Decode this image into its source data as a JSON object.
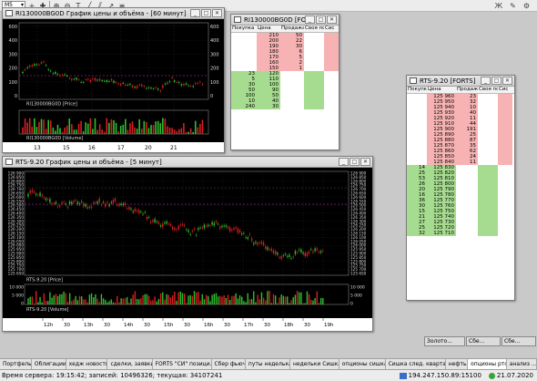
{
  "toolbar": {
    "interval": "M5"
  },
  "win1": {
    "title": "RI130000BG0D График цены и объёма - [60 минут]",
    "price_label": "RI130000BG0D [Price]",
    "volume_label": "RI130000BG0D [Volume]",
    "y_ticks": [
      "600",
      "400",
      "300",
      "200",
      "100",
      "0"
    ],
    "dates": [
      "13",
      "15",
      "16",
      "17",
      "20",
      "21"
    ]
  },
  "win2": {
    "title": "RI130000BG0D [FORTS]",
    "columns": [
      "Покупка",
      "Цена",
      "Продажа",
      "Своя по",
      "Сис"
    ],
    "asks": [
      {
        "price": "210",
        "qty": "50"
      },
      {
        "price": "200",
        "qty": "22"
      },
      {
        "price": "190",
        "qty": "30"
      },
      {
        "price": "180",
        "qty": "6"
      },
      {
        "price": "170",
        "qty": "5"
      },
      {
        "price": "160",
        "qty": "2"
      },
      {
        "price": "150",
        "qty": "1"
      }
    ],
    "bids": [
      {
        "qty": "23",
        "price": "120"
      },
      {
        "qty": "5",
        "price": "110"
      },
      {
        "qty": "30",
        "price": "100"
      },
      {
        "qty": "50",
        "price": "90"
      },
      {
        "qty": "100",
        "price": "50"
      },
      {
        "qty": "10",
        "price": "40"
      },
      {
        "qty": "240",
        "price": "30"
      }
    ]
  },
  "win3": {
    "title": "RTS-9.20 График цены и объёма - [5 минут]",
    "price_label": "RTS-9.20 [Price]",
    "volume_label": "RTS-9.20 [Volume]",
    "y_ticks": [
      "126 900",
      "126 850",
      "126 800",
      "126 750",
      "126 700",
      "126 650",
      "126 600",
      "126 550",
      "126 500",
      "126 450",
      "126 400",
      "126 350",
      "126 300",
      "126 250",
      "126 200",
      "126 150",
      "126 100",
      "126 050",
      "126 000",
      "125 950",
      "125 900",
      "125 850",
      "125 800",
      "125 750",
      "125 700",
      "125 650"
    ],
    "vol_ticks": [
      "10 000",
      "5 000",
      "0"
    ],
    "time_ticks": [
      "12h",
      "30",
      "13h",
      "30",
      "14h",
      "30",
      "15h",
      "30",
      "16h",
      "30",
      "17h",
      "30",
      "18h",
      "30",
      "19h"
    ]
  },
  "win4": {
    "title": "RTS-9.20 [FORTS]",
    "columns": [
      "Покупка",
      "Цена",
      "Продажа",
      "Своя по",
      "Сис"
    ],
    "asks": [
      {
        "price": "125 960",
        "qty": "23"
      },
      {
        "price": "125 950",
        "qty": "32"
      },
      {
        "price": "125 940",
        "qty": "10"
      },
      {
        "price": "125 930",
        "qty": "40"
      },
      {
        "price": "125 920",
        "qty": "11"
      },
      {
        "price": "125 910",
        "qty": "44"
      },
      {
        "price": "125 900",
        "qty": "191"
      },
      {
        "price": "125 890",
        "qty": "25"
      },
      {
        "price": "125 880",
        "qty": "87"
      },
      {
        "price": "125 870",
        "qty": "35"
      },
      {
        "price": "125 860",
        "qty": "62"
      },
      {
        "price": "125 850",
        "qty": "24"
      },
      {
        "price": "125 840",
        "qty": "11"
      }
    ],
    "bids": [
      {
        "qty": "14",
        "price": "125 830"
      },
      {
        "qty": "25",
        "price": "125 820"
      },
      {
        "qty": "53",
        "price": "125 810"
      },
      {
        "qty": "26",
        "price": "125 800"
      },
      {
        "qty": "20",
        "price": "125 790"
      },
      {
        "qty": "16",
        "price": "125 780"
      },
      {
        "qty": "36",
        "price": "125 770"
      },
      {
        "qty": "30",
        "price": "125 760"
      },
      {
        "qty": "15",
        "price": "125 750"
      },
      {
        "qty": "21",
        "price": "125 740"
      },
      {
        "qty": "27",
        "price": "125 730"
      },
      {
        "qty": "25",
        "price": "125 720"
      },
      {
        "qty": "32",
        "price": "125 710"
      }
    ]
  },
  "minimized": [
    "Золото...",
    "Сбе...",
    "Сбе..."
  ],
  "tabs": [
    "Портфель",
    "Облигации",
    "хедж новости",
    "сделки, заявки",
    "FORTS \"СИ\" позици...",
    "Сбер фьюч",
    "путы неделька",
    "недельки Сишка",
    "опционы сишка",
    "Сишка след. квартал",
    "нефть",
    "опционы ртс",
    "анализ ..."
  ],
  "active_tab": 11,
  "status": {
    "left": "Время сервера: 19:15:42; записей: 10496326; текущая: 34107241",
    "connection": "194.247.150.89:15100",
    "date": "21.07.2020"
  },
  "colors": {
    "ask": "#f7b3b3",
    "bid": "#a6dc8f",
    "up": "#2fbf2f",
    "down": "#d62020",
    "grid": "#4a4a4a",
    "level": "#cc33cc"
  }
}
